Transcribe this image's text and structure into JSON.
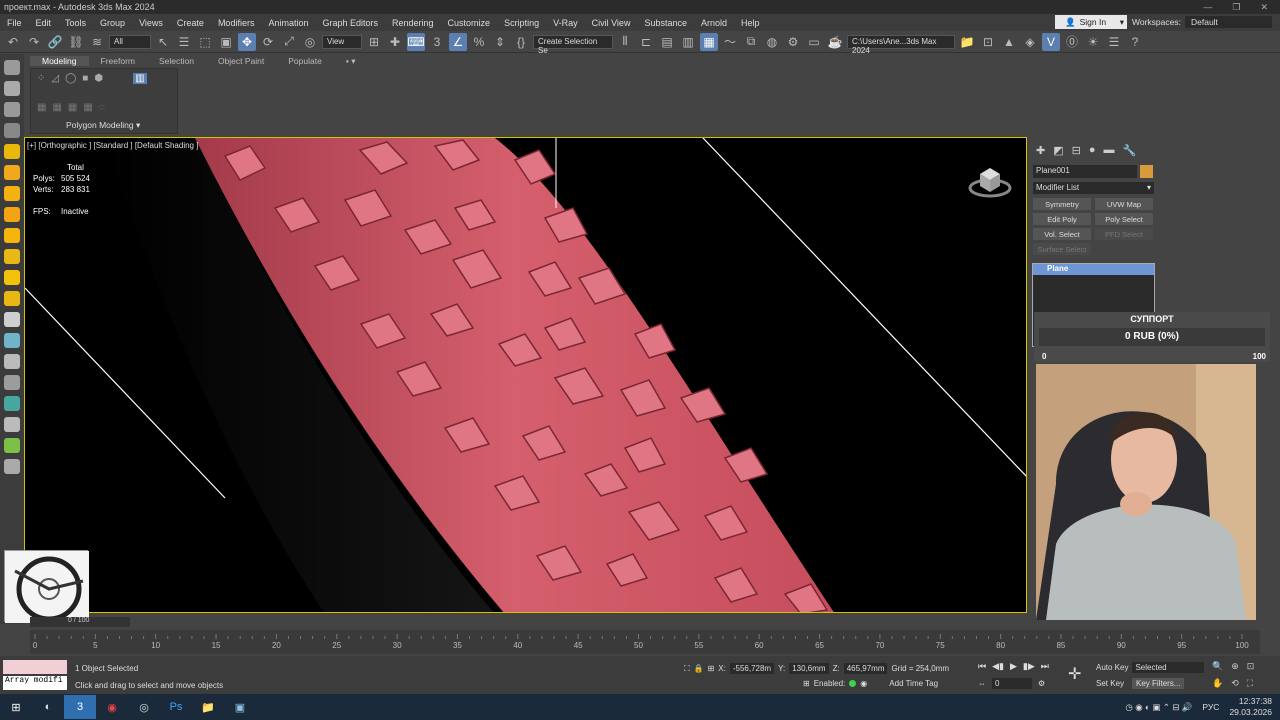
{
  "window": {
    "title": "проект.max - Autodesk 3ds Max 2024"
  },
  "menu": [
    "File",
    "Edit",
    "Tools",
    "Group",
    "Views",
    "Create",
    "Modifiers",
    "Animation",
    "Graph Editors",
    "Rendering",
    "Customize",
    "Scripting",
    "V-Ray",
    "Civil View",
    "Substance",
    "Arnold",
    "Help"
  ],
  "signin": "Sign In",
  "workspaces": {
    "label": "Workspaces:",
    "value": "Default"
  },
  "toolbar": {
    "filter": "All",
    "refcoord": "View",
    "selection_set": "Create Selection Se",
    "path": "C:\\Users\\Ane...3ds Max 2024"
  },
  "ribbon": {
    "tabs": [
      "Modeling",
      "Freeform",
      "Selection",
      "Object Paint",
      "Populate"
    ],
    "panel_label": "Polygon Modeling"
  },
  "viewport": {
    "label": "[+] [Orthographic ] [Standard ] [Default Shading ]",
    "stats": {
      "total_label": "Total",
      "polys_label": "Polys:",
      "polys": "505 524",
      "verts_label": "Verts:",
      "verts": "283 831",
      "fps_label": "FPS:",
      "fps": "Inactive"
    },
    "colors": {
      "tire": "#c9505f",
      "background": "#000000",
      "border": "#d6c200"
    }
  },
  "command_panel": {
    "object_name": "Plane001",
    "modifier_list": "Modifier List",
    "buttons": [
      "Symmetry",
      "UVW Map",
      "Edit Poly",
      "Poly Select",
      "Vol. Select",
      "PFD Select",
      "Surface Select"
    ],
    "stack_item": "Plane"
  },
  "support": {
    "title": "СУППОРТ",
    "amount": "0 RUB (0%)",
    "min": "0",
    "max": "100"
  },
  "timeline": {
    "frame": "0 / 100",
    "ticks": [
      "0",
      "5",
      "10",
      "15",
      "20",
      "25",
      "30",
      "35",
      "40",
      "45",
      "50",
      "55",
      "60",
      "65",
      "70",
      "75",
      "80",
      "85",
      "90",
      "95",
      "100"
    ]
  },
  "status": {
    "maxscript": "Array modifi",
    "selected": "1 Object Selected",
    "prompt": "Click and drag to select and move objects",
    "x_label": "X:",
    "x": "-556,728m",
    "y_label": "Y:",
    "y": "130,6mm",
    "z_label": "Z:",
    "z": "465,97mm",
    "grid": "Grid = 254,0mm",
    "enabled": "Enabled:",
    "add_time_tag": "Add Time Tag",
    "auto_key": "Auto Key",
    "selected_set": "Selected",
    "set_key": "Set Key",
    "key_filters": "Key Filters...",
    "frame_field": "0"
  },
  "taskbar": {
    "lang": "РУС",
    "time": "12:37:38",
    "date": "29.03.2026"
  }
}
